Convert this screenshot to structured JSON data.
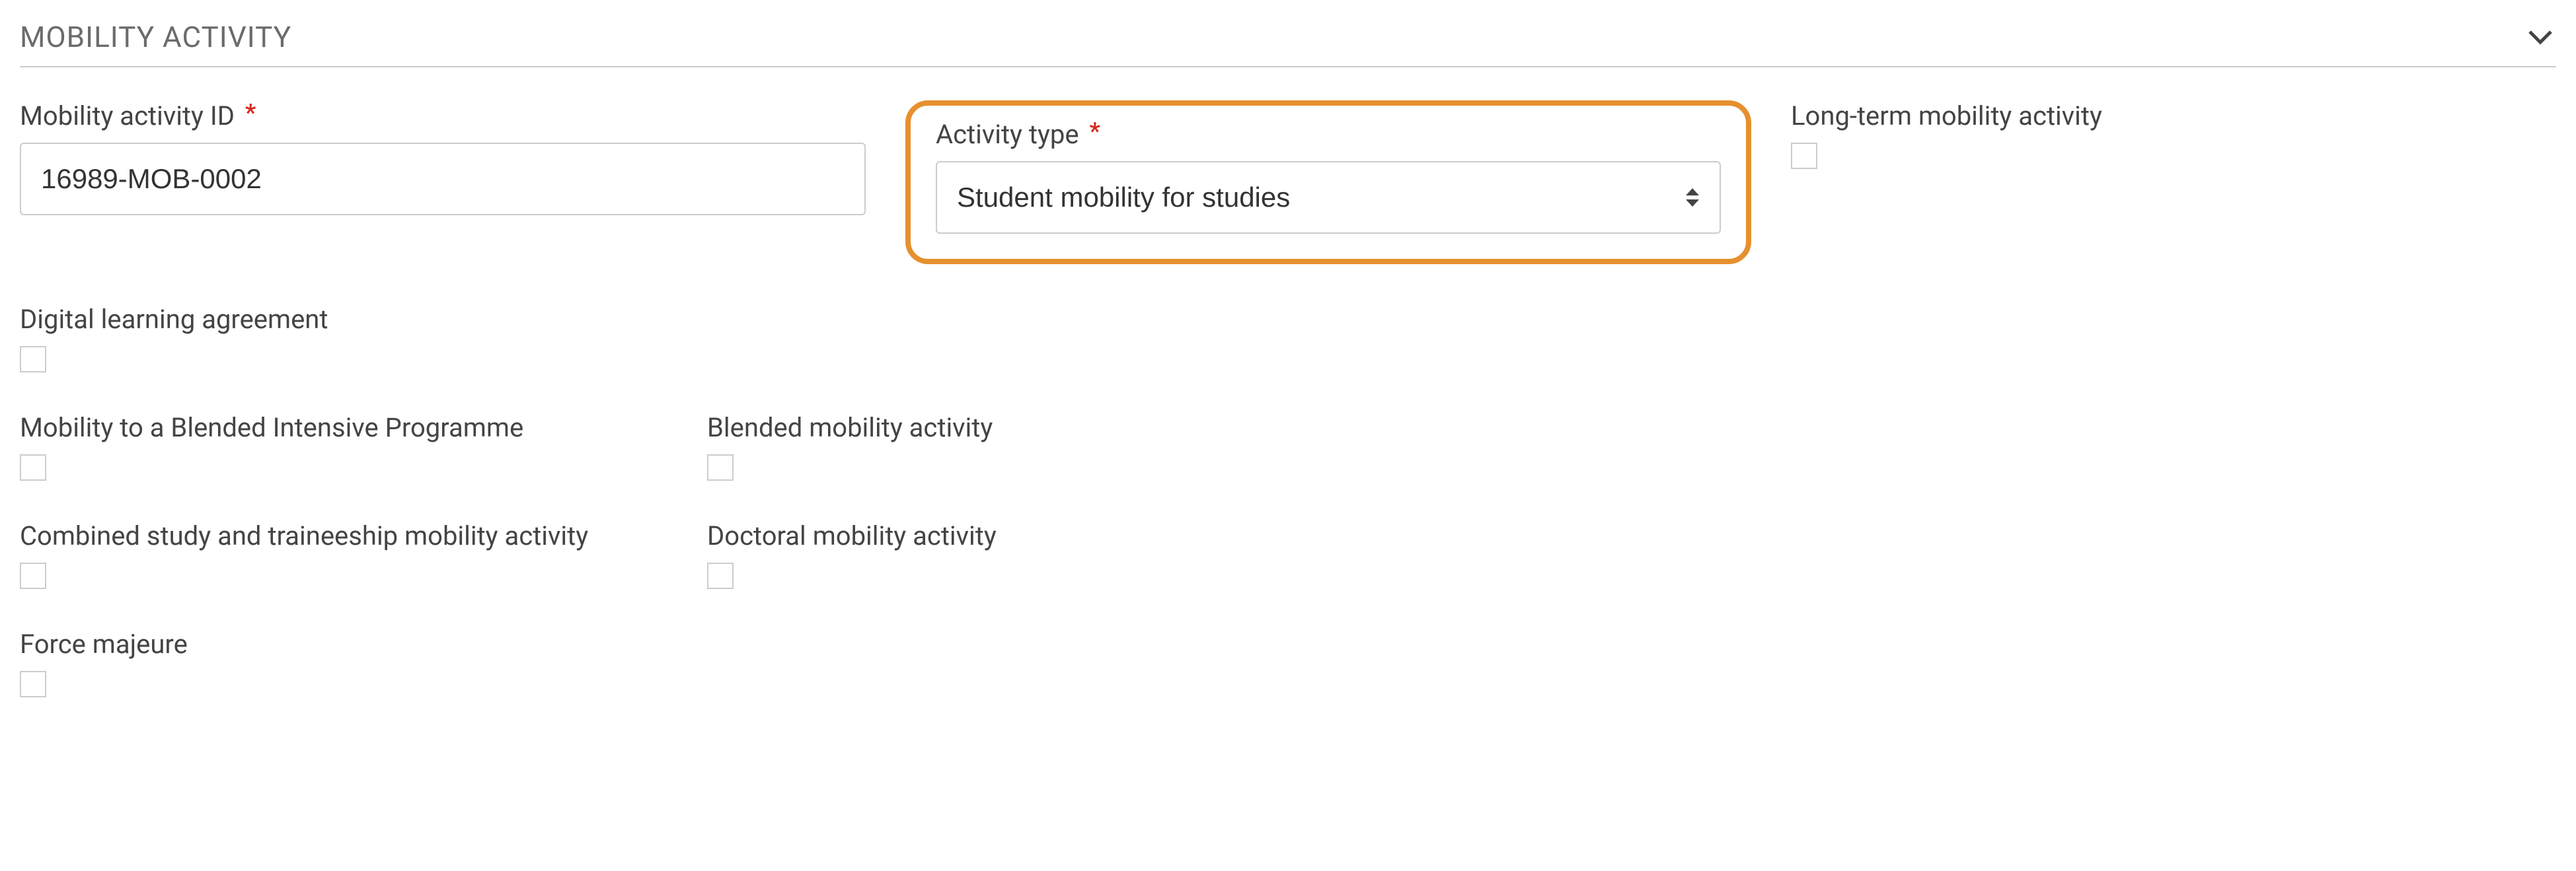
{
  "section": {
    "title": "MOBILITY ACTIVITY"
  },
  "fields": {
    "mobility_id": {
      "label": "Mobility activity ID",
      "value": "16989-MOB-0002"
    },
    "activity_type": {
      "label": "Activity type",
      "value": "Student mobility for studies"
    },
    "long_term": {
      "label": "Long-term mobility activity"
    },
    "digital_la": {
      "label": "Digital learning agreement"
    },
    "blended_ip": {
      "label": "Mobility to a Blended Intensive Programme"
    },
    "blended_activity": {
      "label": "Blended mobility activity"
    },
    "combined": {
      "label": "Combined study and traineeship mobility activity"
    },
    "doctoral": {
      "label": "Doctoral mobility activity"
    },
    "force_majeure": {
      "label": "Force majeure"
    }
  }
}
